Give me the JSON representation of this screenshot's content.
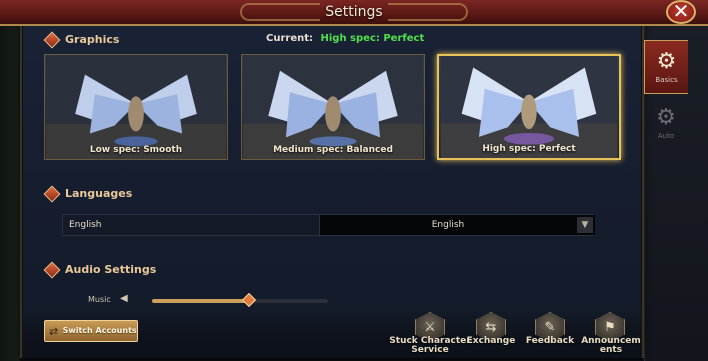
{
  "window": {
    "title": "Settings",
    "close_symbol": "✕"
  },
  "graphics": {
    "section_label": "Graphics",
    "current_label": "Current:",
    "current_value": "High spec: Perfect",
    "current_color": "#4fe04a",
    "options": [
      {
        "label": "Low spec: Smooth",
        "selected": false
      },
      {
        "label": "Medium spec: Balanced",
        "selected": false
      },
      {
        "label": "High spec: Perfect",
        "selected": true
      }
    ]
  },
  "languages": {
    "section_label": "Languages",
    "current_text": "English",
    "dropdown_value": "English",
    "dropdown_arrow": "▼"
  },
  "audio": {
    "section_label": "Audio Settings",
    "music_label": "Music",
    "music_level_percent": 55
  },
  "footer": {
    "switch_accounts_label": "Switch Accounts",
    "buttons": [
      {
        "label": "Stuck Character Service",
        "icon": "stuck-character-icon"
      },
      {
        "label": "Exchange",
        "icon": "exchange-icon"
      },
      {
        "label": "Feedback",
        "icon": "feedback-icon"
      },
      {
        "label": "Announcements",
        "icon": "announcements-icon"
      }
    ]
  },
  "tabs": [
    {
      "label": "Basics",
      "icon": "gear-icon",
      "active": true
    },
    {
      "label": "Auto",
      "icon": "gamepad-icon",
      "active": false
    }
  ],
  "colors": {
    "accent_gold": "#c9a15a",
    "title_red": "#7a2622",
    "selected_border": "#e8c35a"
  }
}
